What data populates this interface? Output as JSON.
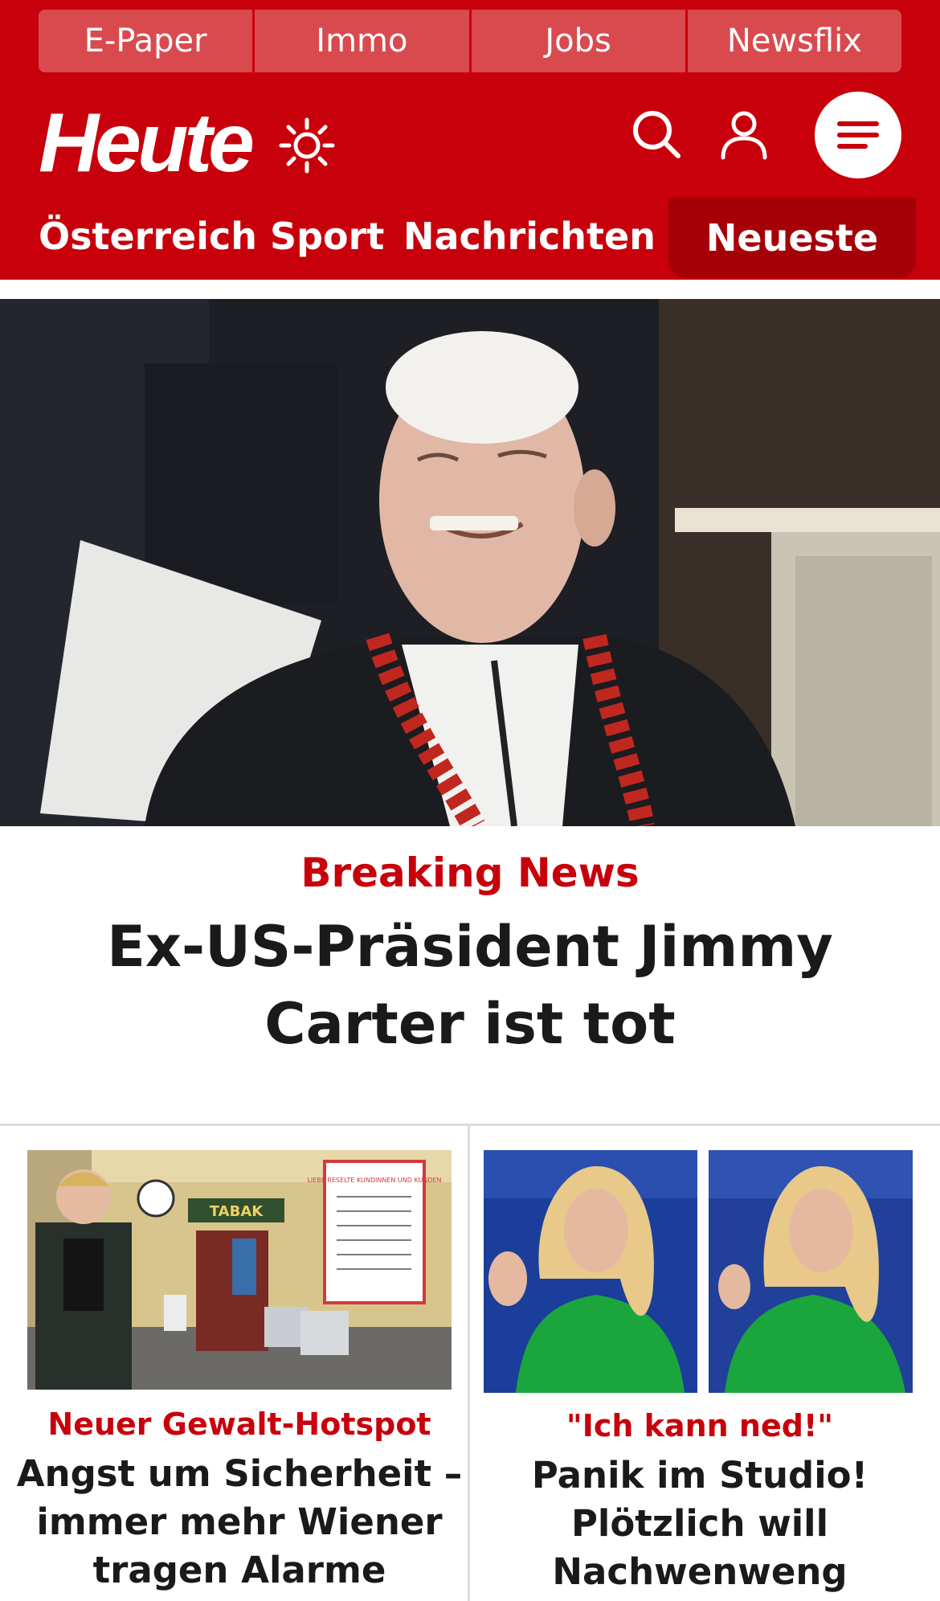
{
  "header": {
    "top_links": [
      "E-Paper",
      "Immo",
      "Jobs",
      "Newsflix"
    ],
    "logo": "Heute",
    "icons": {
      "theme": "sun-icon",
      "search": "search-icon",
      "account": "user-icon",
      "menu": "menu-icon"
    },
    "nav": {
      "items": [
        "Österreich",
        "Sport",
        "Nachrichten"
      ],
      "active": "Neueste"
    }
  },
  "hero": {
    "kicker": "Breaking News",
    "title": "Ex-US-Präsident Jimmy Carter ist tot"
  },
  "teasers": [
    {
      "kicker": "Neuer Gewalt-Hotspot",
      "title": "Angst um Sicherheit – immer mehr Wiener tragen Alarme",
      "image_text": {
        "sign": "TABAK",
        "notice": "LIEBE RESELTE KUNDINNEN UND KUNDEN"
      }
    },
    {
      "kicker": "\"Ich kann ned!\"",
      "title": "Panik im Studio! Plötzlich will Nachwenweng fliehen"
    }
  ],
  "colors": {
    "brand": "#c8000b",
    "brand_dark": "#a50008",
    "top_link_bg": "#d94a4f",
    "text": "#1a1a1a"
  }
}
